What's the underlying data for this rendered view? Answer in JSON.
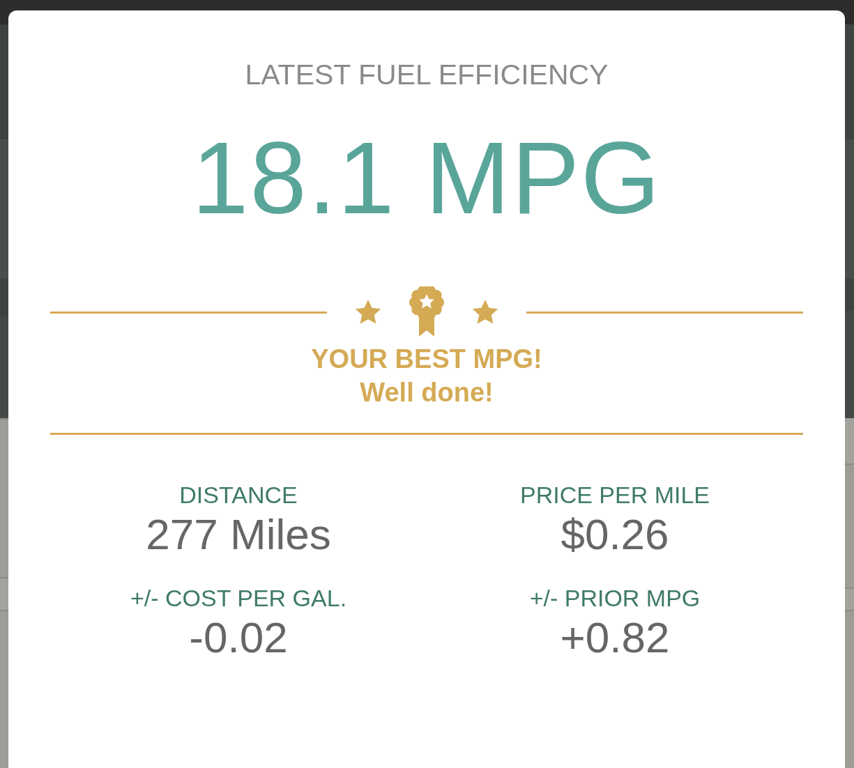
{
  "title": "LATEST FUEL EFFICIENCY",
  "reading": "18.1 MPG",
  "achievement": {
    "title": "YOUR BEST MPG!",
    "subtitle": "Well done!"
  },
  "stats": [
    {
      "label": "DISTANCE",
      "value": "277 Miles"
    },
    {
      "label": "PRICE PER MILE",
      "value": "$0.26"
    },
    {
      "label": "+/- COST PER GAL.",
      "value": "-0.02"
    },
    {
      "label": "+/- PRIOR MPG",
      "value": "+0.82"
    }
  ]
}
